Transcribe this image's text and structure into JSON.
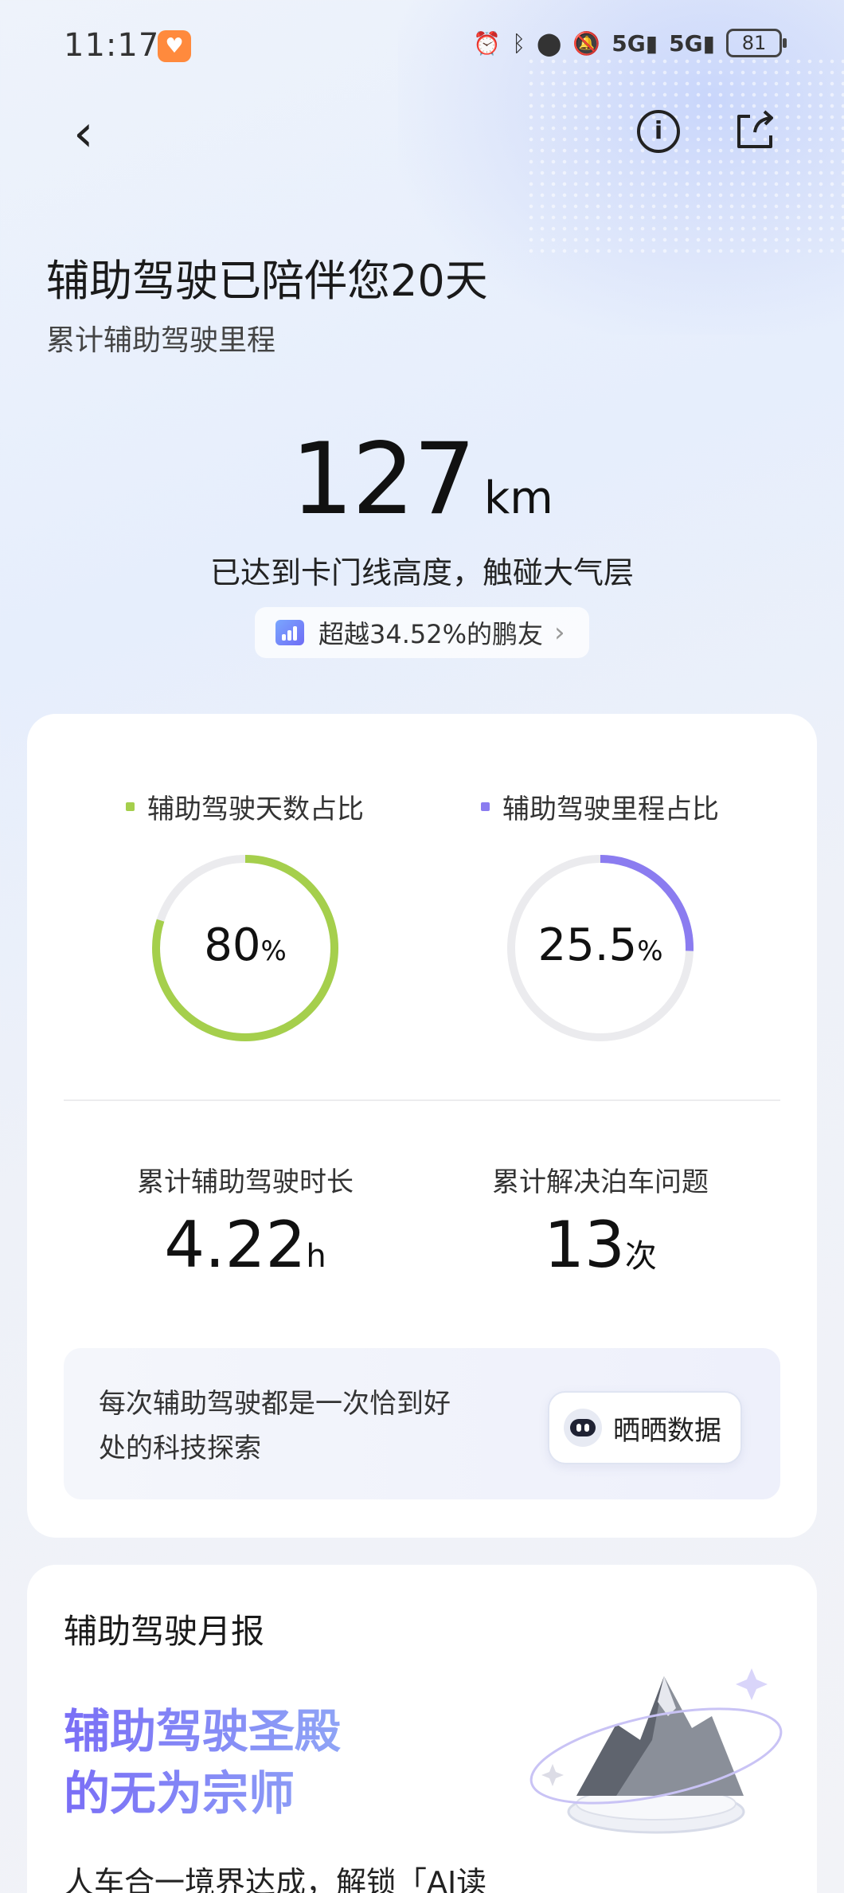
{
  "status_bar": {
    "time": "11:17",
    "battery": "81",
    "signal_1": "5G",
    "signal_2": "5G"
  },
  "header": {
    "title": "辅助驾驶已陪伴您20天",
    "subtitle": "累计辅助驾驶里程",
    "mileage_value": "127",
    "mileage_unit": "km",
    "mileage_desc": "已达到卡门线高度，触碰大气层",
    "rank_text": "超越34.52%的鹏友"
  },
  "stats": {
    "days_ratio": {
      "label": "辅助驾驶天数占比",
      "value": "80",
      "unit": "%",
      "fraction": 0.8,
      "color": "#a5cf4c"
    },
    "mileage_ratio": {
      "label": "辅助驾驶里程占比",
      "value": "25.5",
      "unit": "%",
      "fraction": 0.255,
      "color": "#8b7cf0"
    },
    "duration": {
      "label": "累计辅助驾驶时长",
      "value": "4.22",
      "unit": "h"
    },
    "parking": {
      "label": "累计解决泊车问题",
      "value": "13",
      "unit": "次"
    },
    "share": {
      "text": "每次辅助驾驶都是一次恰到好处的科技探索",
      "button": "晒晒数据"
    }
  },
  "monthly": {
    "title": "辅助驾驶月报",
    "rank_line1": "辅助驾驶圣殿",
    "rank_line2": "的无为宗师",
    "desc": "人车合一境界达成，解锁「AI读"
  },
  "colors": {
    "track": "#ebebee",
    "accent_purple": "#8b7cf0",
    "accent_green": "#a5cf4c"
  },
  "icons": [
    "back-icon",
    "info-icon",
    "share-icon",
    "chart-icon",
    "chevron-right-icon",
    "robot-icon",
    "mountain-trophy-icon"
  ]
}
